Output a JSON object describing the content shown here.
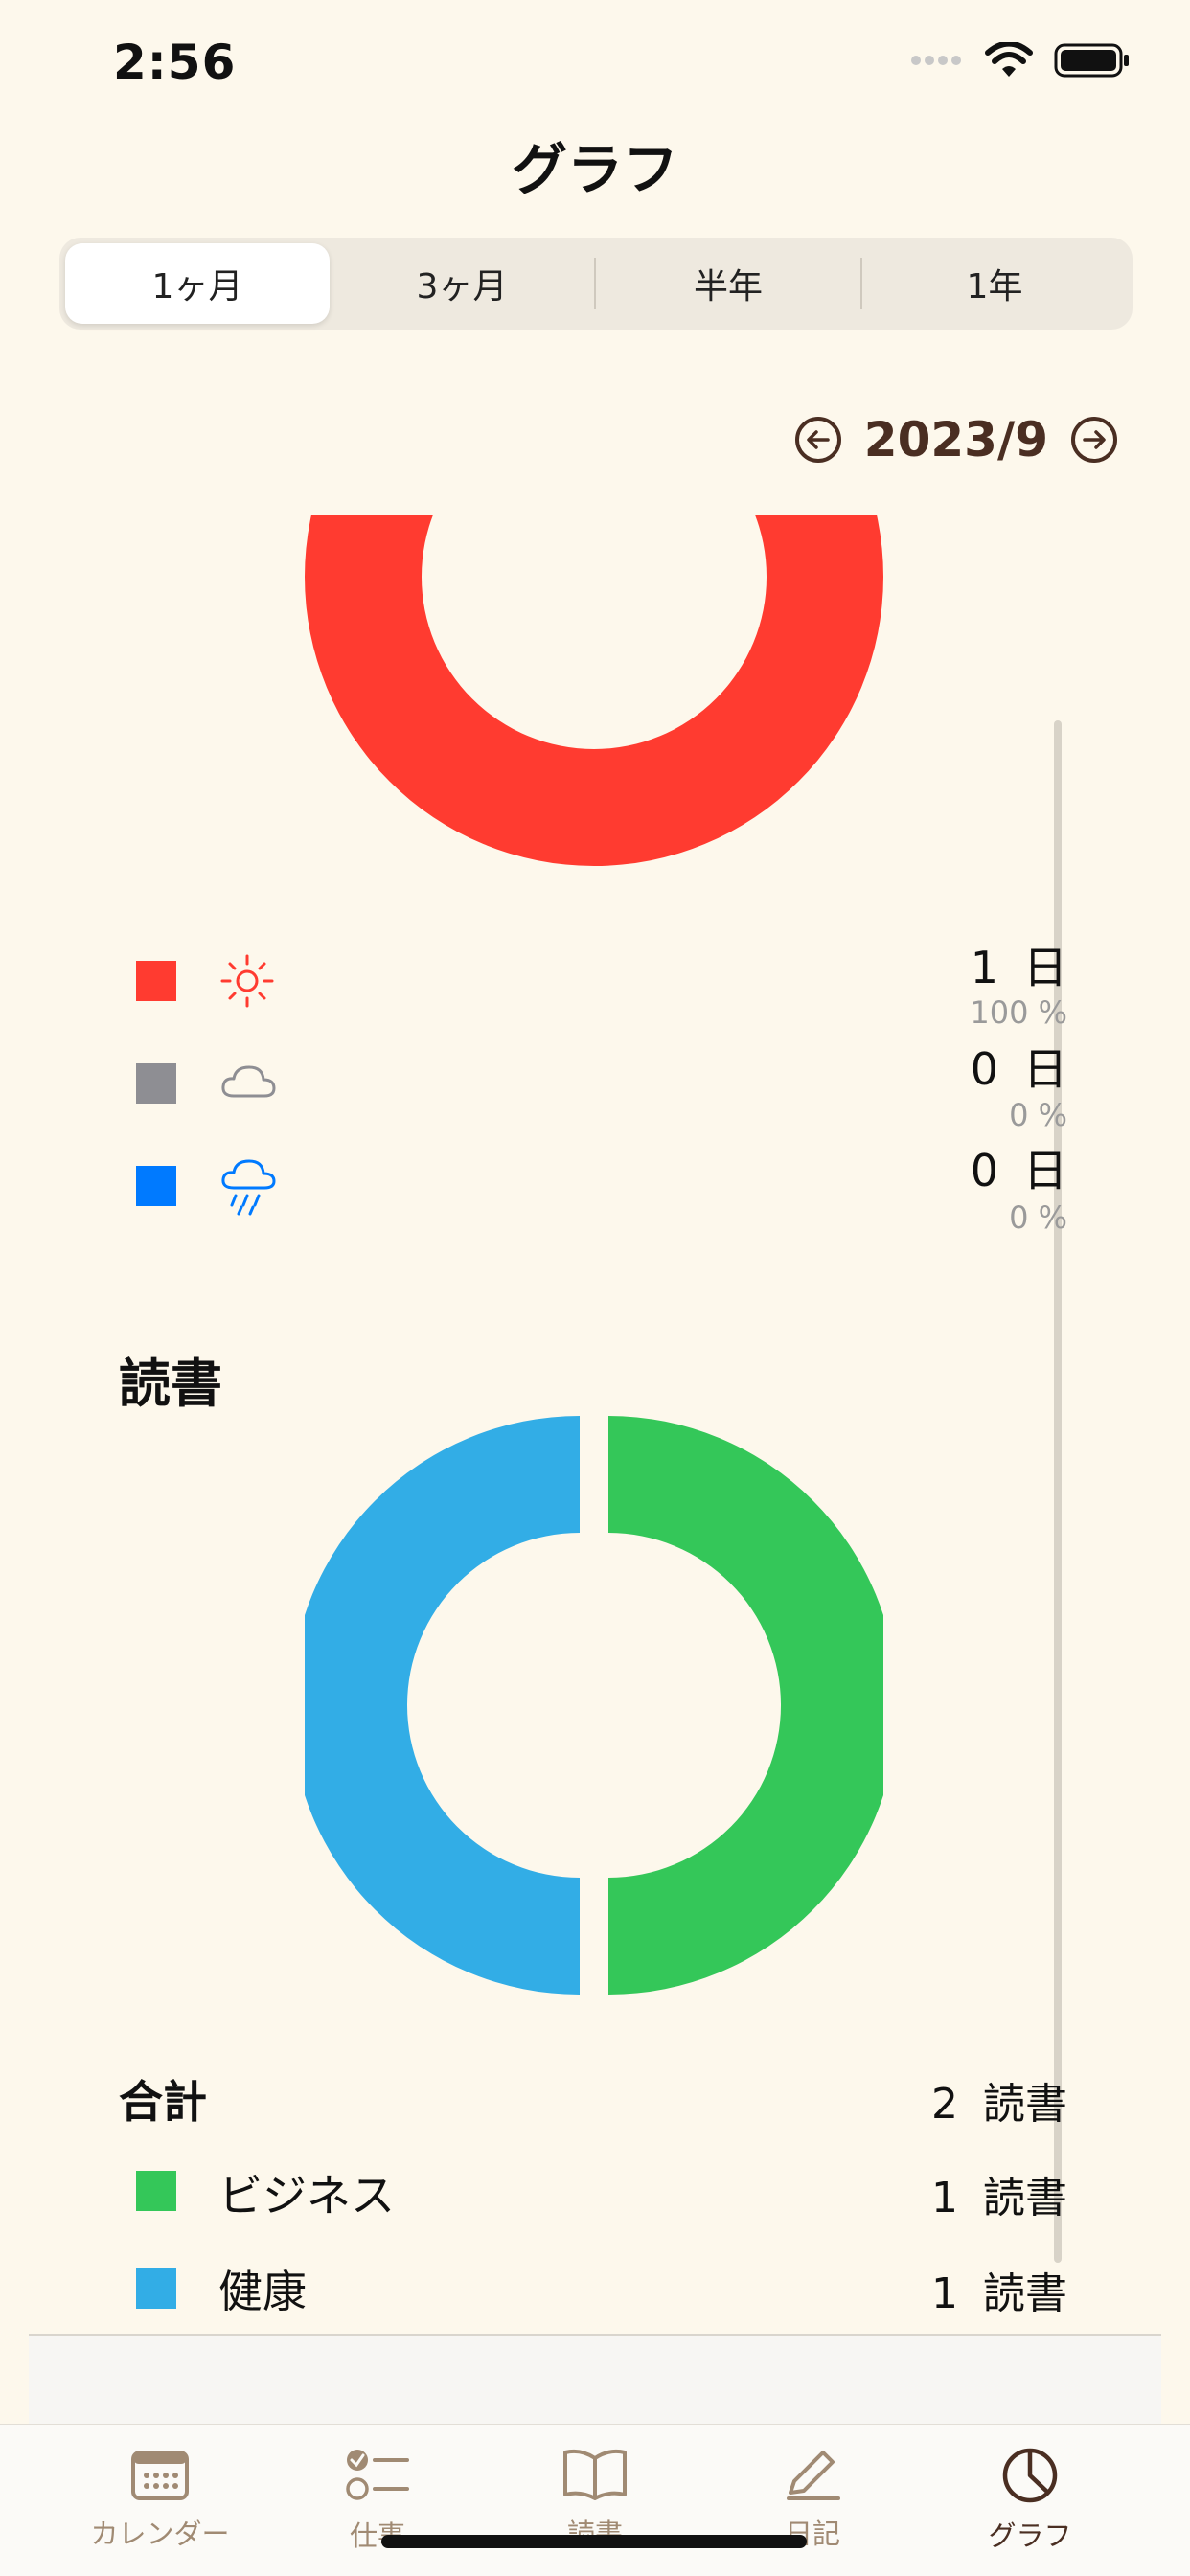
{
  "status_bar": {
    "time": "2:56"
  },
  "header": {
    "title": "グラフ"
  },
  "segments": {
    "items": [
      "1ヶ月",
      "3ヶ月",
      "半年",
      "1年"
    ],
    "active_index": 0
  },
  "date_nav": {
    "label": "2023/9"
  },
  "weather": {
    "chart_data": {
      "type": "pie",
      "categories": [
        "sunny",
        "cloudy",
        "rainy"
      ],
      "values": [
        1,
        0,
        0
      ],
      "colors": [
        "#FF3B30",
        "#8E8E93",
        "#007AFF"
      ]
    },
    "legend": [
      {
        "icon": "sun-icon",
        "color": "#FF3B30",
        "count": "1",
        "unit": "日",
        "percent": "100 %"
      },
      {
        "icon": "cloud-icon",
        "color": "#8E8E93",
        "count": "0",
        "unit": "日",
        "percent": "0 %"
      },
      {
        "icon": "rain-icon",
        "color": "#007AFF",
        "count": "0",
        "unit": "日",
        "percent": "0 %"
      }
    ]
  },
  "reading": {
    "title": "読書",
    "chart_data": {
      "type": "pie",
      "categories": [
        "ビジネス",
        "健康"
      ],
      "values": [
        1,
        1
      ],
      "colors": [
        "#34C759",
        "#32ADE6"
      ]
    },
    "total": {
      "label": "合計",
      "count": "2",
      "unit": "読書"
    },
    "rows": [
      {
        "label": "ビジネス",
        "color": "#34C759",
        "count": "1",
        "unit": "読書"
      },
      {
        "label": "健康",
        "color": "#32ADE6",
        "count": "1",
        "unit": "読書"
      }
    ]
  },
  "tabbar": {
    "items": [
      {
        "label": "カレンダー",
        "icon": "calendar-icon"
      },
      {
        "label": "仕事",
        "icon": "checklist-icon"
      },
      {
        "label": "読書",
        "icon": "book-icon"
      },
      {
        "label": "日記",
        "icon": "pencil-icon"
      },
      {
        "label": "グラフ",
        "icon": "pie-chart-icon"
      }
    ],
    "active_index": 4
  },
  "colors": {
    "accent": "#4A2E22",
    "background": "#FDF8EC",
    "tab_inactive": "#A08A73"
  }
}
